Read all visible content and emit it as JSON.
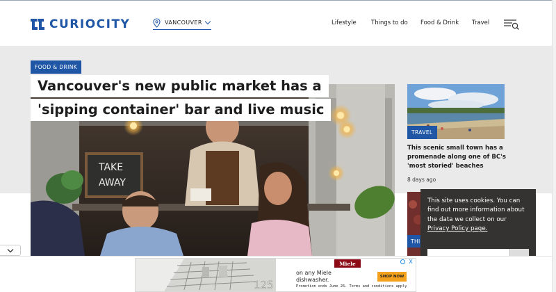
{
  "header": {
    "logo_text": "CURIOCITY",
    "city_selector": {
      "value": "VANCOUVER"
    },
    "nav": [
      "Lifestyle",
      "Things to do",
      "Food & Drink",
      "Travel"
    ]
  },
  "featured": {
    "category": "FOOD & DRINK",
    "title_line_1": "Vancouver's new public market has a",
    "title_line_2": "'sipping container' bar and live music",
    "photo_sign_line_1": "TAKE",
    "photo_sign_line_2": "AWAY"
  },
  "side_stories": [
    {
      "category": "TRAVEL",
      "title": "This scenic small town has a promenade along one of BC's 'most storied' beaches",
      "date": "8 days ago"
    },
    {
      "category": "THI"
    }
  ],
  "cookie_notice": {
    "text_before_link": "This site uses cookies. You can find out more information about the data we collect on our ",
    "link_text": "Privacy Policy page."
  },
  "ad": {
    "brand": "Miele",
    "line_1": "on any Miele",
    "line_2": "dishwasher.",
    "cta": "SHOP NOW",
    "fine_print": "Promotion ends June 26. Terms and conditions apply",
    "image_number": "125",
    "close_label": "X"
  },
  "colors": {
    "brand_blue": "#1f57a6",
    "band_grey": "#eaeaea",
    "cookie_bg": "#343331",
    "ad_brand_red": "#8c0a14",
    "ad_cta_orange": "#f4a21d"
  },
  "icons": [
    "location-pin-icon",
    "chevron-down-icon",
    "menu-search-icon",
    "collapse-chevron-icon",
    "ad-info-icon",
    "close-icon"
  ]
}
